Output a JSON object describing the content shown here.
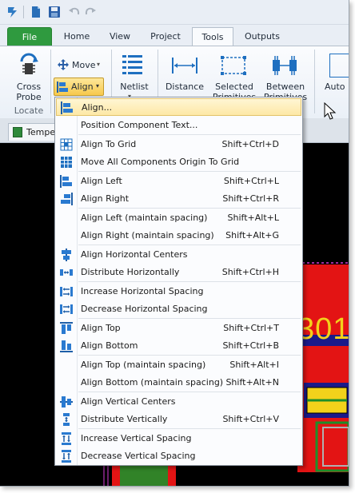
{
  "tabs": {
    "file": "File",
    "home": "Home",
    "view": "View",
    "project": "Project",
    "tools": "Tools",
    "outputs": "Outputs"
  },
  "ribbon": {
    "cross_probe_line1": "Cross",
    "cross_probe_line2": "Probe",
    "locate_group": "Locate",
    "move": "Move",
    "align": "Align",
    "netlist": "Netlist",
    "distance": "Distance",
    "selected_line1": "Selected",
    "selected_line2": "Primitives",
    "between_line1": "Between",
    "between_line2": "Primitives",
    "auto_partial": "Auto"
  },
  "doc_tab": "Tempe",
  "pcb_text": "301",
  "menu": {
    "items": [
      {
        "label": "Align...",
        "shortcut": ""
      },
      {
        "label": "Position Component Text...",
        "shortcut": ""
      },
      {
        "label": "Align To Grid",
        "shortcut": "Shift+Ctrl+D"
      },
      {
        "label": "Move All Components Origin To Grid",
        "shortcut": ""
      },
      {
        "label": "Align Left",
        "shortcut": "Shift+Ctrl+L"
      },
      {
        "label": "Align Right",
        "shortcut": "Shift+Ctrl+R"
      },
      {
        "label": "Align Left (maintain spacing)",
        "shortcut": "Shift+Alt+L"
      },
      {
        "label": "Align Right (maintain spacing)",
        "shortcut": "Shift+Alt+G"
      },
      {
        "label": "Align Horizontal Centers",
        "shortcut": ""
      },
      {
        "label": "Distribute Horizontally",
        "shortcut": "Shift+Ctrl+H"
      },
      {
        "label": "Increase Horizontal Spacing",
        "shortcut": ""
      },
      {
        "label": "Decrease Horizontal Spacing",
        "shortcut": ""
      },
      {
        "label": "Align Top",
        "shortcut": "Shift+Ctrl+T"
      },
      {
        "label": "Align Bottom",
        "shortcut": "Shift+Ctrl+B"
      },
      {
        "label": "Align Top (maintain spacing)",
        "shortcut": "Shift+Alt+I"
      },
      {
        "label": "Align Bottom (maintain spacing)",
        "shortcut": "Shift+Alt+N"
      },
      {
        "label": "Align Vertical Centers",
        "shortcut": ""
      },
      {
        "label": "Distribute Vertically",
        "shortcut": "Shift+Ctrl+V"
      },
      {
        "label": "Increase Vertical Spacing",
        "shortcut": ""
      },
      {
        "label": "Decrease Vertical Spacing",
        "shortcut": ""
      }
    ]
  },
  "colors": {
    "file_tab": "#2f9a3f",
    "highlight": "#fde8a6",
    "pcb_red": "#e31414",
    "pcb_yellow": "#f2d21b"
  }
}
